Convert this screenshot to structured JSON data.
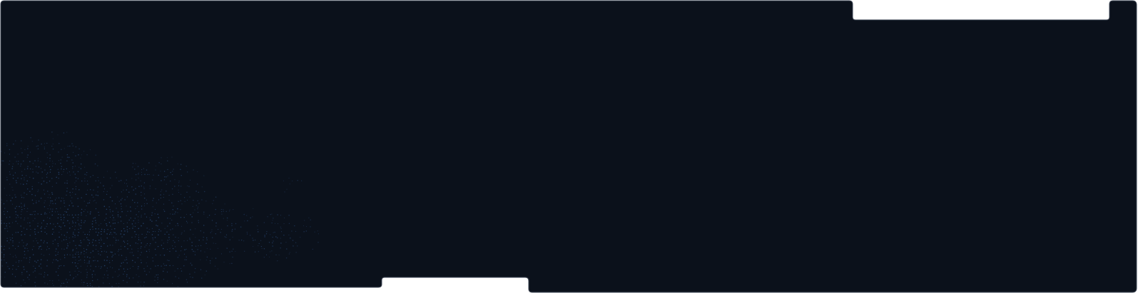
{
  "colors": {
    "page_background": "#ffffff",
    "panel_fill": "#0b111b",
    "panel_border": "#3a4250",
    "dot_color": "#2a4a78"
  },
  "decor": {
    "dot_texture": "halftone-dot-pattern"
  }
}
